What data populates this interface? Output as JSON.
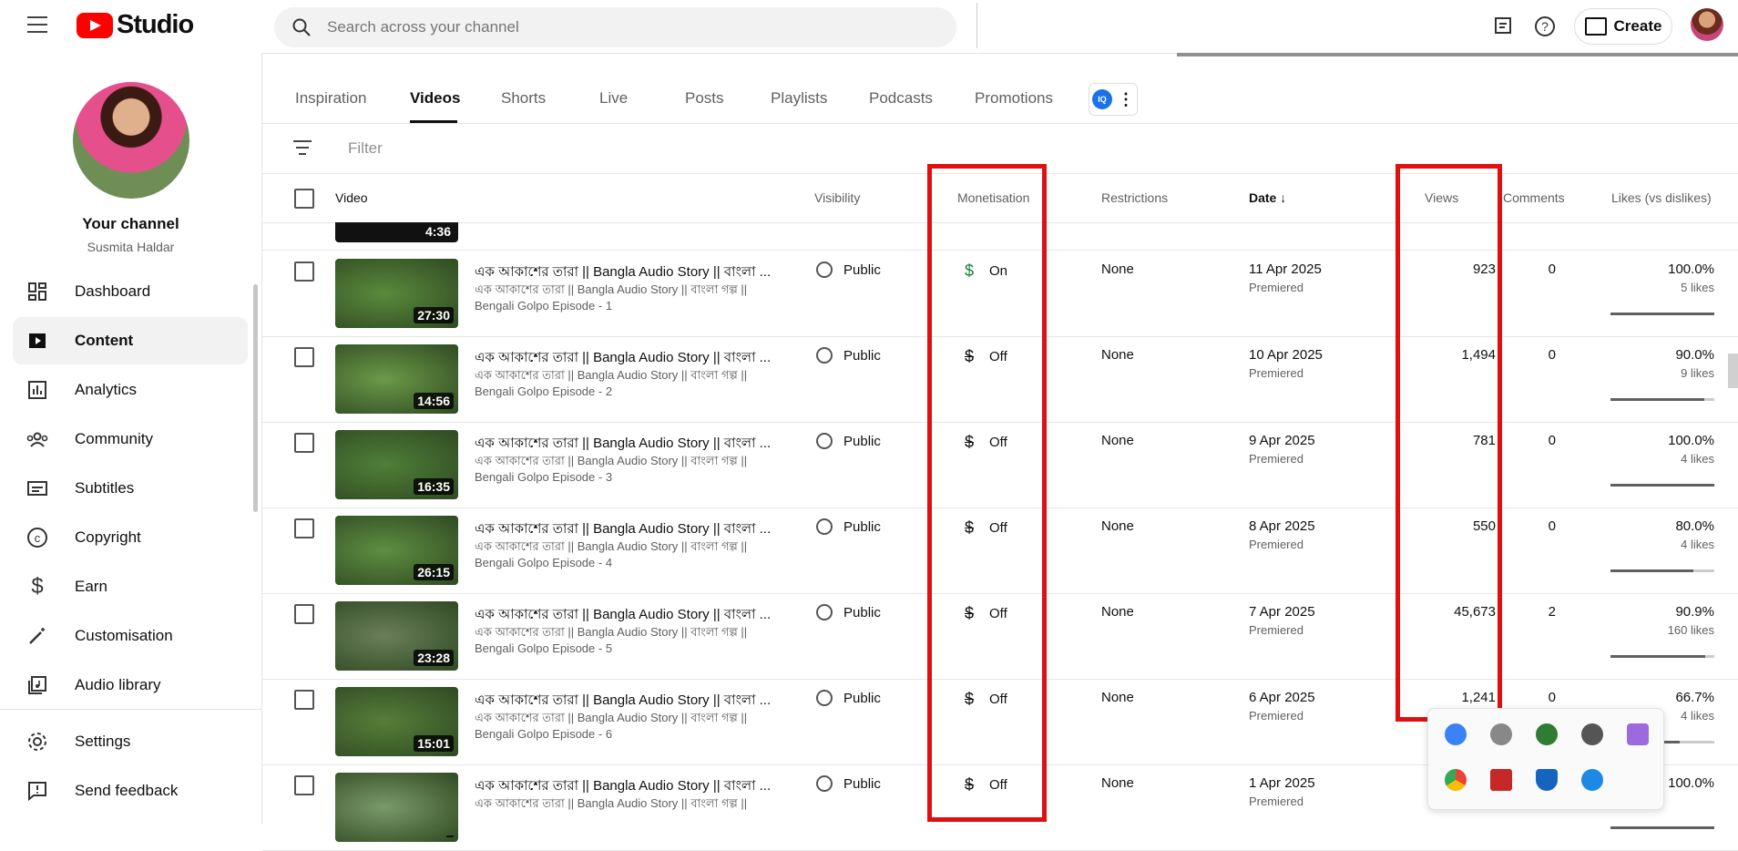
{
  "app": {
    "name": "Studio"
  },
  "search": {
    "placeholder": "Search across your channel"
  },
  "header": {
    "create_label": "Create"
  },
  "channel": {
    "title": "Your channel",
    "name": "Susmita Haldar"
  },
  "sidebar": {
    "items": [
      {
        "label": "Dashboard",
        "icon": "dashboard-icon"
      },
      {
        "label": "Content",
        "icon": "content-icon",
        "active": true
      },
      {
        "label": "Analytics",
        "icon": "analytics-icon"
      },
      {
        "label": "Community",
        "icon": "community-icon"
      },
      {
        "label": "Subtitles",
        "icon": "subtitles-icon"
      },
      {
        "label": "Copyright",
        "icon": "copyright-icon"
      },
      {
        "label": "Earn",
        "icon": "dollar-icon"
      },
      {
        "label": "Customisation",
        "icon": "magic-wand-icon"
      },
      {
        "label": "Audio library",
        "icon": "audio-library-icon"
      }
    ],
    "footer": [
      {
        "label": "Settings",
        "icon": "gear-icon"
      },
      {
        "label": "Send feedback",
        "icon": "feedback-icon"
      }
    ]
  },
  "tabs": [
    "Inspiration",
    "Videos",
    "Shorts",
    "Live",
    "Posts",
    "Playlists",
    "Podcasts",
    "Promotions"
  ],
  "active_tab": "Videos",
  "tab_extension": {
    "label": "IQ"
  },
  "filter": {
    "placeholder": "Filter"
  },
  "table": {
    "headers": {
      "video": "Video",
      "visibility": "Visibility",
      "monetisation": "Monetisation",
      "restrictions": "Restrictions",
      "date": "Date",
      "views": "Views",
      "comments": "Comments",
      "likes": "Likes (vs dislikes)"
    },
    "partial_row_duration": "4:36",
    "rows": [
      {
        "title": "এক আকাশের তারা || Bangla Audio Story || বাংলা ...",
        "desc1": "এক আকাশের তারা || Bangla Audio Story || বাংলা গল্প ||",
        "desc2": "Bengali Golpo Episode - 1",
        "duration": "27:30",
        "visibility": "Public",
        "monetisation": "On",
        "restrictions": "None",
        "date": "11 Apr 2025",
        "date_sub": "Premiered",
        "views": "923",
        "comments": "0",
        "likes_pct": "100.0%",
        "likes_count": "5 likes",
        "like_ratio": 1.0
      },
      {
        "title": "এক আকাশের তারা || Bangla Audio Story || বাংলা ...",
        "desc1": "এক আকাশের তারা || Bangla Audio Story || বাংলা গল্প ||",
        "desc2": "Bengali Golpo Episode - 2",
        "duration": "14:56",
        "visibility": "Public",
        "monetisation": "Off",
        "restrictions": "None",
        "date": "10 Apr 2025",
        "date_sub": "Premiered",
        "views": "1,494",
        "comments": "0",
        "likes_pct": "90.0%",
        "likes_count": "9 likes",
        "like_ratio": 0.9
      },
      {
        "title": "এক আকাশের তারা || Bangla Audio Story || বাংলা ...",
        "desc1": "এক আকাশের তারা || Bangla Audio Story || বাংলা গল্প ||",
        "desc2": "Bengali Golpo Episode - 3",
        "duration": "16:35",
        "visibility": "Public",
        "monetisation": "Off",
        "restrictions": "None",
        "date": "9 Apr 2025",
        "date_sub": "Premiered",
        "views": "781",
        "comments": "0",
        "likes_pct": "100.0%",
        "likes_count": "4 likes",
        "like_ratio": 1.0
      },
      {
        "title": "এক আকাশের তারা || Bangla Audio Story || বাংলা ...",
        "desc1": "এক আকাশের তারা || Bangla Audio Story || বাংলা গল্প ||",
        "desc2": "Bengali Golpo Episode - 4",
        "duration": "26:15",
        "visibility": "Public",
        "monetisation": "Off",
        "restrictions": "None",
        "date": "8 Apr 2025",
        "date_sub": "Premiered",
        "views": "550",
        "comments": "0",
        "likes_pct": "80.0%",
        "likes_count": "4 likes",
        "like_ratio": 0.8
      },
      {
        "title": "এক আকাশের তারা || Bangla Audio Story || বাংলা ...",
        "desc1": "এক আকাশের তারা || Bangla Audio Story || বাংলা গল্প ||",
        "desc2": "Bengali Golpo Episode - 5",
        "duration": "23:28",
        "visibility": "Public",
        "monetisation": "Off",
        "restrictions": "None",
        "date": "7 Apr 2025",
        "date_sub": "Premiered",
        "views": "45,673",
        "comments": "2",
        "likes_pct": "90.9%",
        "likes_count": "160 likes",
        "like_ratio": 0.909
      },
      {
        "title": "এক আকাশের তারা || Bangla Audio Story || বাংলা ...",
        "desc1": "এক আকাশের তারা || Bangla Audio Story || বাংলা গল্প ||",
        "desc2": "Bengali Golpo Episode - 6",
        "duration": "15:01",
        "visibility": "Public",
        "monetisation": "Off",
        "restrictions": "None",
        "date": "6 Apr 2025",
        "date_sub": "Premiered",
        "views": "1,241",
        "comments": "0",
        "likes_pct": "66.7%",
        "likes_count": "4 likes",
        "like_ratio": 0.667
      },
      {
        "title": "এক আকাশের তারা || Bangla Audio Story || বাংলা ...",
        "desc1": "এক আকাশের তারা || Bangla Audio Story || বাংলা গল্প ||",
        "desc2": "",
        "duration": "",
        "visibility": "Public",
        "monetisation": "Off",
        "restrictions": "None",
        "date": "1 Apr 2025",
        "date_sub": "Premiered",
        "views": "",
        "comments": "",
        "likes_pct": "100.0%",
        "likes_count": "",
        "like_ratio": 1.0
      }
    ]
  },
  "colors": {
    "brand_red": "#ff0000",
    "highlight_red": "#e01010",
    "monetisation_on": "#188038"
  }
}
